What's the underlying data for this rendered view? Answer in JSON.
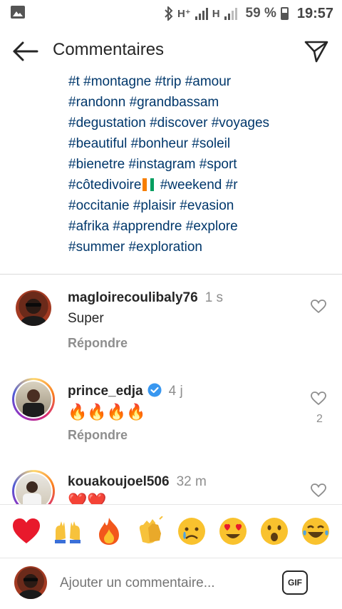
{
  "status_bar": {
    "network_1": "H⁺",
    "network_2": "H",
    "battery": "59 %",
    "time": "19:57"
  },
  "header": {
    "title": "Commentaires"
  },
  "caption": {
    "lines": [
      "#t #montagne #trip #amour",
      "#randonn #grandbassam",
      "#degustation #discover #voyages",
      "#beautiful #bonheur #soleil",
      "#bienetre #instagram #sport",
      "#côtedivoire",
      "#occitanie #plaisir #evasion",
      "#afrika #apprendre #explore",
      "#summer #exploration"
    ],
    "line6_suffix": "#weekend #r"
  },
  "comments": [
    {
      "username": "magloirecoulibaly76",
      "time": "1 s",
      "text": "Super",
      "reply_label": "Répondre"
    },
    {
      "username": "prince_edja",
      "time": "4 j",
      "text": "🔥🔥🔥🔥",
      "reply_label": "Répondre",
      "likes": "2"
    },
    {
      "username": "kouakoujoel506",
      "time": "32 m"
    }
  ],
  "emoji_bar": [
    "heart-emoji",
    "raising-hands-emoji",
    "fire-emoji",
    "clapping-hands-emoji",
    "crying-face-emoji",
    "heart-eyes-emoji",
    "surprised-face-emoji",
    "laughing-tears-emoji"
  ],
  "composer": {
    "placeholder": "Ajouter un commentaire...",
    "gif_label": "GIF"
  },
  "colors": {
    "hashtag": "#00376b",
    "muted": "#8e8e8e",
    "verified": "#3897f0"
  }
}
